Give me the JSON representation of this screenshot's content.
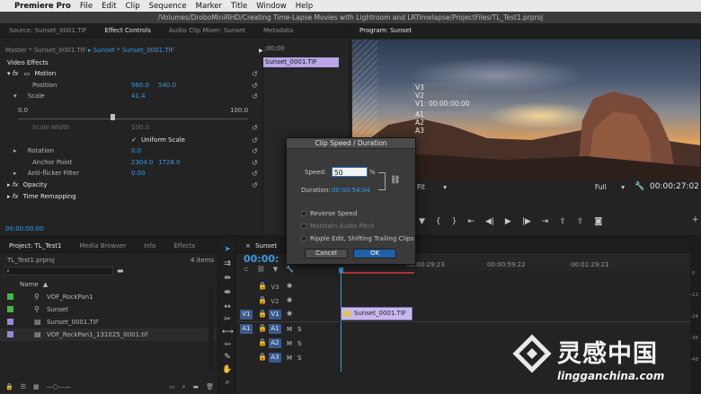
{
  "menubar": {
    "app": "Premiere Pro",
    "items": [
      "File",
      "Edit",
      "Clip",
      "Sequence",
      "Marker",
      "Title",
      "Window",
      "Help"
    ]
  },
  "path": "/Volumes/DroboMiniRHD/Creating Time-Lapse Movies with Lightroom and LRTimelapse/ProjectFiles/TL_Test1.prproj",
  "source_panel": {
    "tabs": [
      "Source: Sunset_0001.TIF",
      "Effect Controls",
      "Audio Clip Mixer: Sunset",
      "Metadata"
    ],
    "active_tab": "Effect Controls",
    "master_label": "Master * Sunset_0001.TIF",
    "clip_label": "Sunset * Sunset_0001.TIF",
    "timecode_start": ";00;00",
    "clip_bar_label": "Sunset_0001.TIF",
    "video_effects": "Video Effects",
    "motion": "Motion",
    "position_label": "Position",
    "position_x": "960.0",
    "position_y": "540.0",
    "scale_label": "Scale",
    "scale_value": "41.4",
    "slider_min": "0.0",
    "slider_max": "100.0",
    "scale_width_label": "Scale Width",
    "scale_width_value": "100.0",
    "uniform_scale": "Uniform Scale",
    "rotation_label": "Rotation",
    "rotation_value": "0.0",
    "anchor_label": "Anchor Point",
    "anchor_x": "2304.0",
    "anchor_y": "1728.0",
    "antiflicker_label": "Anti-flicker Filter",
    "antiflicker_value": "0.00",
    "opacity": "Opacity",
    "time_remapping": "Time Remapping",
    "bottom_timecode": "00:00:00:00"
  },
  "program": {
    "tab": "Program: Sunset",
    "overlay_video": [
      "V3",
      "V2",
      "V1: 00:00:00:00"
    ],
    "overlay_audio": [
      "A1",
      "A2",
      "A3"
    ],
    "fit": "Fit",
    "quality": "Full",
    "timecode": "00:00:27:02"
  },
  "dialog": {
    "title": "Clip Speed / Duration",
    "speed_label": "Speed:",
    "speed_value": "50",
    "speed_unit": "%",
    "duration_label": "Duration:",
    "duration_value": "00:00:54:04",
    "reverse": "Reverse Speed",
    "maintain": "Maintain Audio Pitch",
    "ripple": "Ripple Edit, Shifting Trailing Clips",
    "cancel": "Cancel",
    "ok": "OK"
  },
  "project": {
    "tabs": [
      "Project: TL_Test1",
      "Media Browser",
      "Info",
      "Effects"
    ],
    "filename": "TL_Test1.prproj",
    "items_count": "4 items",
    "name_header": "Name",
    "rows": [
      {
        "name": "VOF_RockPan1",
        "color": "#3fb84a"
      },
      {
        "name": "Sunset",
        "color": "#3fb84a"
      },
      {
        "name": "Sunset_0001.TIF",
        "color": "#9b86d6"
      },
      {
        "name": "VOF_RockPan1_131025_0001.tif",
        "color": "#9b86d6"
      }
    ]
  },
  "timeline": {
    "tab": "Sunset",
    "timecode": "00:00:",
    "ruler": [
      "00:00:29:23",
      "00:00:59:22",
      "00:01:29:21"
    ],
    "video_tracks": [
      "V3",
      "V2",
      "V1"
    ],
    "audio_tracks": [
      "A1",
      "A2",
      "A3"
    ],
    "source_v": "V1",
    "source_a": "A1",
    "mute": "M",
    "solo": "S",
    "clip": "Sunset_0001.TIF",
    "meter_labels": [
      "0",
      "-12",
      "-24",
      "-36",
      "-48"
    ]
  },
  "watermark": {
    "cn": "灵感中国",
    "url": "lingganchina.com"
  }
}
